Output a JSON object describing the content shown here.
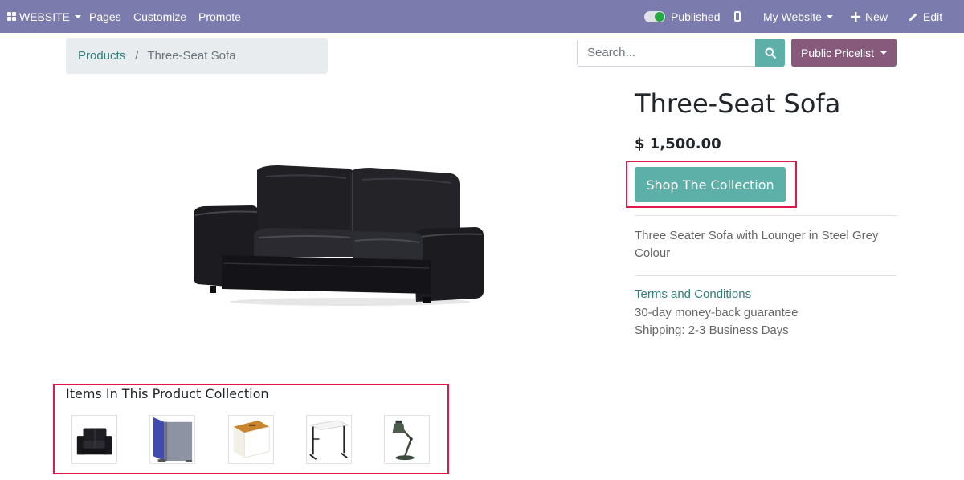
{
  "navbar": {
    "website_label": "WEBSITE",
    "pages_label": "Pages",
    "customize_label": "Customize",
    "promote_label": "Promote",
    "published_label": "Published",
    "my_website_label": "My Website",
    "new_label": "New",
    "edit_label": "Edit",
    "icons": [
      "apps-grid-icon",
      "toggle-switch-icon",
      "mobile-preview-icon",
      "plus-icon",
      "pencil-icon"
    ]
  },
  "breadcrumb": {
    "parent": "Products",
    "separator": "/",
    "current": "Three-Seat Sofa"
  },
  "search": {
    "placeholder": "Search...",
    "icon": "search-icon"
  },
  "pricelist": {
    "label": "Public Pricelist"
  },
  "product": {
    "title": "Three-Seat Sofa",
    "price": "$ 1,500.00",
    "cta_label": "Shop The Collection",
    "description": "Three Seater Sofa with Lounger in Steel Grey Colour",
    "terms_label": "Terms and Conditions",
    "guarantee": "30-day money-back guarantee",
    "shipping": "Shipping: 2-3 Business Days",
    "image": "black-leather-sofa-image"
  },
  "collection": {
    "title": "Items In This Product Collection",
    "items": [
      {
        "image": "black-loveseat-thumbnail"
      },
      {
        "image": "blue-panel-screen-thumbnail"
      },
      {
        "image": "wooden-top-storage-box-thumbnail"
      },
      {
        "image": "white-desk-thumbnail"
      },
      {
        "image": "desk-lamp-thumbnail"
      }
    ]
  },
  "colors": {
    "navbar": "#7c7bad",
    "accent_teal": "#5cb0a7",
    "pricelist_button": "#875a7b",
    "link": "#2e7f7b",
    "highlight": "#e0174b"
  }
}
